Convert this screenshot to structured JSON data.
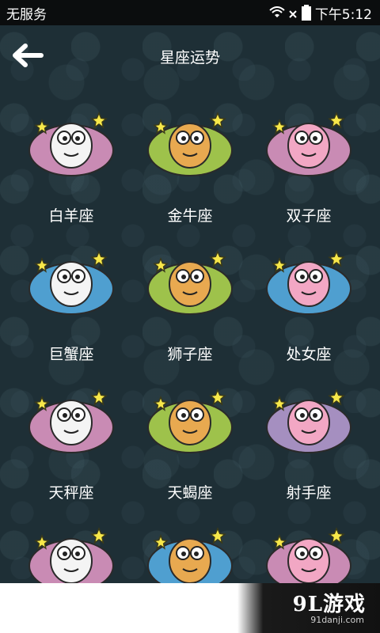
{
  "status_bar": {
    "carrier": "无服务",
    "time": "下午5:12",
    "icons": [
      "wifi-icon",
      "no-signal-icon",
      "battery-icon"
    ]
  },
  "header": {
    "title": "星座运势",
    "back_icon": "arrow-left-icon"
  },
  "signs": [
    {
      "label": "白羊座",
      "icon": "aries-sheep-icon",
      "color": "#c98bb4"
    },
    {
      "label": "金牛座",
      "icon": "taurus-bull-icon",
      "color": "#9ec24b"
    },
    {
      "label": "双子座",
      "icon": "gemini-twins-icon",
      "color": "#c98bb4"
    },
    {
      "label": "巨蟹座",
      "icon": "cancer-crab-icon",
      "color": "#4f9fd0"
    },
    {
      "label": "狮子座",
      "icon": "leo-lion-icon",
      "color": "#9ec24b"
    },
    {
      "label": "处女座",
      "icon": "virgo-girl-icon",
      "color": "#4f9fd0"
    },
    {
      "label": "天秤座",
      "icon": "libra-scale-icon",
      "color": "#c98bb4"
    },
    {
      "label": "天蝎座",
      "icon": "scorpio-scorpion-icon",
      "color": "#9ec24b"
    },
    {
      "label": "射手座",
      "icon": "sagittarius-bow-icon",
      "color": "#a58fc0"
    },
    {
      "label": "",
      "icon": "capricorn-goat-icon",
      "color": "#c98bb4"
    },
    {
      "label": "",
      "icon": "aquarius-icon",
      "color": "#4f9fd0"
    },
    {
      "label": "",
      "icon": "pisces-fish-icon",
      "color": "#c98bb4"
    }
  ],
  "watermark": {
    "logo": "9L游戏",
    "url": "91danji.com"
  }
}
